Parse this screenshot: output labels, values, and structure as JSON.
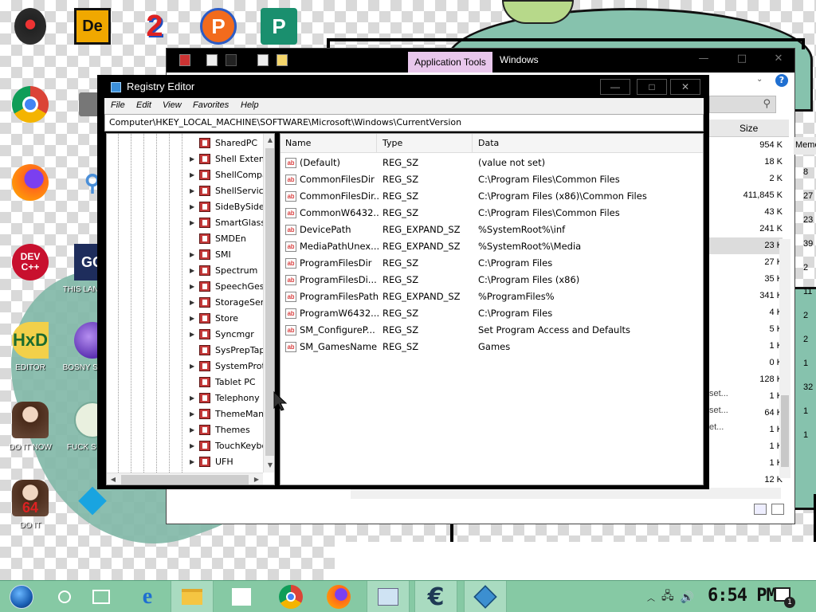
{
  "desktop": {
    "icons": [
      {
        "name": "hal-icon",
        "label": "",
        "glyph": "◉",
        "bg": "#222",
        "fg": "#c33"
      },
      {
        "name": "de-icon",
        "label": "",
        "glyph": "De",
        "bg": "#f0a800",
        "fg": "#111"
      },
      {
        "name": "two-icon",
        "label": "",
        "glyph": "2",
        "bg": "transparent",
        "fg": "#d22"
      },
      {
        "name": "p-icon",
        "label": "",
        "glyph": "P",
        "bg": "#f26b1d",
        "fg": "#fff"
      },
      {
        "name": "publisher-icon",
        "label": "",
        "glyph": "P",
        "bg": "#1a8f6e",
        "fg": "#fff"
      },
      {
        "name": "chrome-icon",
        "label": "",
        "glyph": "",
        "bg": "transparent",
        "fg": ""
      },
      {
        "name": "firefox-icon",
        "label": "",
        "glyph": "",
        "bg": "transparent",
        "fg": ""
      },
      {
        "name": "devcpp-icon",
        "label": "",
        "glyph": "DEV C++",
        "bg": "#c8102e",
        "fg": "#fff"
      },
      {
        "name": "go-icon",
        "label": "THIS LANGUAG",
        "glyph": "GO",
        "bg": "#1e2d5c",
        "fg": "#fff"
      },
      {
        "name": "hxd-icon",
        "label": "EDITOR",
        "glyph": "HxD",
        "bg": "transparent",
        "fg": "#1c6b2e"
      },
      {
        "name": "bosny-icon",
        "label": "BOSNY SIMULA",
        "glyph": "",
        "bg": "transparent",
        "fg": ""
      },
      {
        "name": "portrait-icon",
        "label": "DO IT NOW",
        "glyph": "",
        "bg": "transparent",
        "fg": ""
      },
      {
        "name": "elves-icon",
        "label": "FUCK S ELVE",
        "glyph": "",
        "bg": "transparent",
        "fg": ""
      },
      {
        "name": "portrait64-icon",
        "label": "DO IT",
        "glyph": "64",
        "bg": "transparent",
        "fg": "#d22"
      },
      {
        "name": "diamond-icon",
        "label": "",
        "glyph": "◆",
        "bg": "transparent",
        "fg": "#19a4e0"
      }
    ]
  },
  "explorer": {
    "app_tools": "Application Tools",
    "title": "Windows",
    "size_header": "Size",
    "sizes": [
      "954 K",
      "18 K",
      "2 K",
      "411,845 K",
      "43 K",
      "241 K",
      "23 K",
      "27 K",
      "35 K",
      "341 K",
      "4 K",
      "5 K",
      "1 K",
      "0 K",
      "128 K",
      "1 K",
      "64 K",
      "1 K",
      "1 K",
      "1 K",
      "12 K"
    ],
    "memo_header": "Memo",
    "memo_values": [
      "8",
      "27",
      "23",
      "39",
      "2",
      "11",
      "2",
      "2",
      "1",
      "32",
      "1",
      "1"
    ]
  },
  "regedit": {
    "title": "Registry Editor",
    "menu": [
      "File",
      "Edit",
      "View",
      "Favorites",
      "Help"
    ],
    "address": "Computer\\HKEY_LOCAL_MACHINE\\SOFTWARE\\Microsoft\\Windows\\CurrentVersion",
    "tree": [
      {
        "label": "SharedPC",
        "arrow": false
      },
      {
        "label": "Shell Extensions",
        "arrow": true
      },
      {
        "label": "ShellCompatibility",
        "arrow": true
      },
      {
        "label": "ShellServiceObjects",
        "arrow": true
      },
      {
        "label": "SideBySide",
        "arrow": true
      },
      {
        "label": "SmartGlass",
        "arrow": true
      },
      {
        "label": "SMDEn",
        "arrow": false
      },
      {
        "label": "SMI",
        "arrow": true
      },
      {
        "label": "Spectrum",
        "arrow": true
      },
      {
        "label": "SpeechGestures",
        "arrow": true
      },
      {
        "label": "StorageSense",
        "arrow": true
      },
      {
        "label": "Store",
        "arrow": true
      },
      {
        "label": "Syncmgr",
        "arrow": true
      },
      {
        "label": "SysPrepTapi",
        "arrow": false
      },
      {
        "label": "SystemProtectedUserData",
        "arrow": true
      },
      {
        "label": "Tablet PC",
        "arrow": false
      },
      {
        "label": "Telephony",
        "arrow": true
      },
      {
        "label": "ThemeManager",
        "arrow": true
      },
      {
        "label": "Themes",
        "arrow": true
      },
      {
        "label": "TouchKeyboard",
        "arrow": true
      },
      {
        "label": "UFH",
        "arrow": true
      }
    ],
    "columns": {
      "name": "Name",
      "type": "Type",
      "data": "Data"
    },
    "values": [
      {
        "name": "(Default)",
        "type": "REG_SZ",
        "data": "(value not set)"
      },
      {
        "name": "CommonFilesDir",
        "type": "REG_SZ",
        "data": "C:\\Program Files\\Common Files"
      },
      {
        "name": "CommonFilesDir...",
        "type": "REG_SZ",
        "data": "C:\\Program Files (x86)\\Common Files"
      },
      {
        "name": "CommonW6432...",
        "type": "REG_SZ",
        "data": "C:\\Program Files\\Common Files"
      },
      {
        "name": "DevicePath",
        "type": "REG_EXPAND_SZ",
        "data": "%SystemRoot%\\inf"
      },
      {
        "name": "MediaPathUnex...",
        "type": "REG_EXPAND_SZ",
        "data": "%SystemRoot%\\Media"
      },
      {
        "name": "ProgramFilesDir",
        "type": "REG_SZ",
        "data": "C:\\Program Files"
      },
      {
        "name": "ProgramFilesDi...",
        "type": "REG_SZ",
        "data": "C:\\Program Files (x86)"
      },
      {
        "name": "ProgramFilesPath",
        "type": "REG_EXPAND_SZ",
        "data": "%ProgramFiles%"
      },
      {
        "name": "ProgramW6432...",
        "type": "REG_SZ",
        "data": "C:\\Program Files"
      },
      {
        "name": "SM_ConfigureP...",
        "type": "REG_SZ",
        "data": "Set Program Access and Defaults"
      },
      {
        "name": "SM_GamesName",
        "type": "REG_SZ",
        "data": "Games"
      }
    ],
    "value_icon": "ab"
  },
  "taskbar": {
    "apps": [
      "start-button",
      "cortana-button",
      "task-view-button",
      "edge-icon",
      "file-explorer-icon",
      "store-icon",
      "chrome-icon",
      "firefox-icon",
      "regedit-task-icon",
      "ccleaner-icon",
      "app-cube-icon"
    ],
    "clock": "6:54 PM",
    "notification_count": "1"
  }
}
